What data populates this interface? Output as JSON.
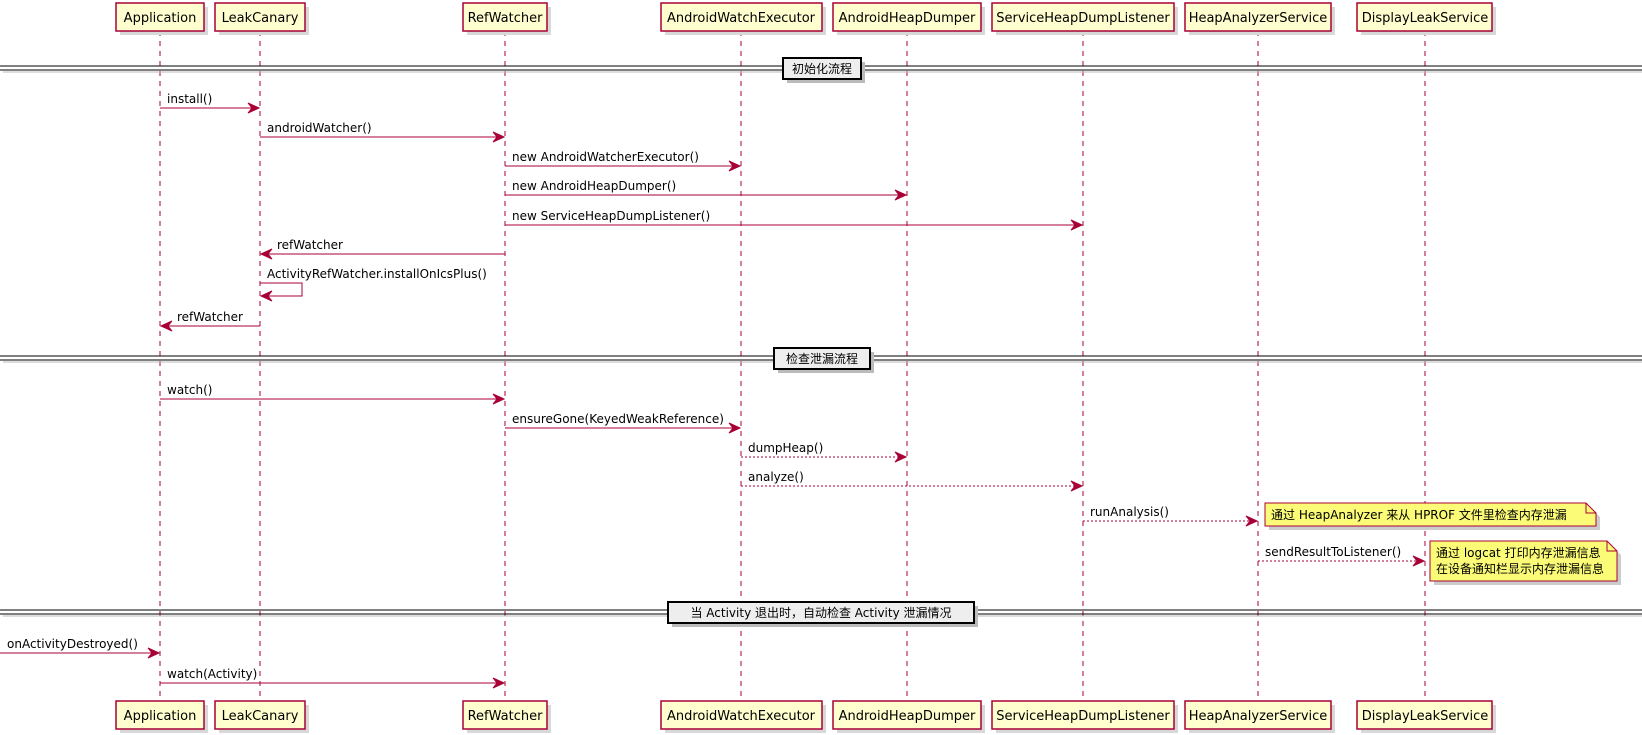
{
  "participants": [
    {
      "id": "application",
      "label": "Application"
    },
    {
      "id": "leakcanary",
      "label": "LeakCanary"
    },
    {
      "id": "refwatcher",
      "label": "RefWatcher"
    },
    {
      "id": "androidwatchexecutor",
      "label": "AndroidWatchExecutor"
    },
    {
      "id": "androidheapdumper",
      "label": "AndroidHeapDumper"
    },
    {
      "id": "serviceheapdumplistener",
      "label": "ServiceHeapDumpListener"
    },
    {
      "id": "heapanalyzerservice",
      "label": "HeapAnalyzerService"
    },
    {
      "id": "displayleakservice",
      "label": "DisplayLeakService"
    }
  ],
  "dividers": [
    {
      "label": "初始化流程"
    },
    {
      "label": "检查泄漏流程"
    },
    {
      "label": "当 Activity 退出时，自动检查 Activity 泄漏情况"
    }
  ],
  "messages": [
    {
      "from": "application",
      "to": "leakcanary",
      "label": "install()",
      "style": "solid"
    },
    {
      "from": "leakcanary",
      "to": "refwatcher",
      "label": "androidWatcher()",
      "style": "solid"
    },
    {
      "from": "refwatcher",
      "to": "androidwatchexecutor",
      "label": "new AndroidWatcherExecutor()",
      "style": "solid"
    },
    {
      "from": "refwatcher",
      "to": "androidheapdumper",
      "label": "new AndroidHeapDumper()",
      "style": "solid"
    },
    {
      "from": "refwatcher",
      "to": "serviceheapdumplistener",
      "label": "new ServiceHeapDumpListener()",
      "style": "solid"
    },
    {
      "from": "refwatcher",
      "to": "leakcanary",
      "label": "refWatcher",
      "style": "solid"
    },
    {
      "from": "leakcanary",
      "to": "leakcanary",
      "label": "ActivityRefWatcher.installOnIcsPlus()",
      "style": "solid"
    },
    {
      "from": "leakcanary",
      "to": "application",
      "label": "refWatcher",
      "style": "solid"
    },
    {
      "from": "application",
      "to": "refwatcher",
      "label": "watch()",
      "style": "solid"
    },
    {
      "from": "refwatcher",
      "to": "androidwatchexecutor",
      "label": "ensureGone(KeyedWeakReference)",
      "style": "solid"
    },
    {
      "from": "androidwatchexecutor",
      "to": "androidheapdumper",
      "label": "dumpHeap()",
      "style": "dashed"
    },
    {
      "from": "androidwatchexecutor",
      "to": "serviceheapdumplistener",
      "label": "analyze()",
      "style": "dashed"
    },
    {
      "from": "serviceheapdumplistener",
      "to": "heapanalyzerservice",
      "label": "runAnalysis()",
      "style": "dashed"
    },
    {
      "from": "heapanalyzerservice",
      "to": "displayleakservice",
      "label": "sendResultToListener()",
      "style": "dashed"
    },
    {
      "from": "external",
      "to": "application",
      "label": "onActivityDestroyed()",
      "style": "solid"
    },
    {
      "from": "application",
      "to": "refwatcher",
      "label": "watch(Activity)",
      "style": "solid"
    }
  ],
  "notes": [
    {
      "lines": [
        "通过 HeapAnalyzer 来从 HPROF 文件里检查内存泄漏"
      ]
    },
    {
      "lines": [
        "通过 logcat 打印内存泄漏信息",
        "在设备通知栏显示内存泄漏信息"
      ]
    }
  ]
}
